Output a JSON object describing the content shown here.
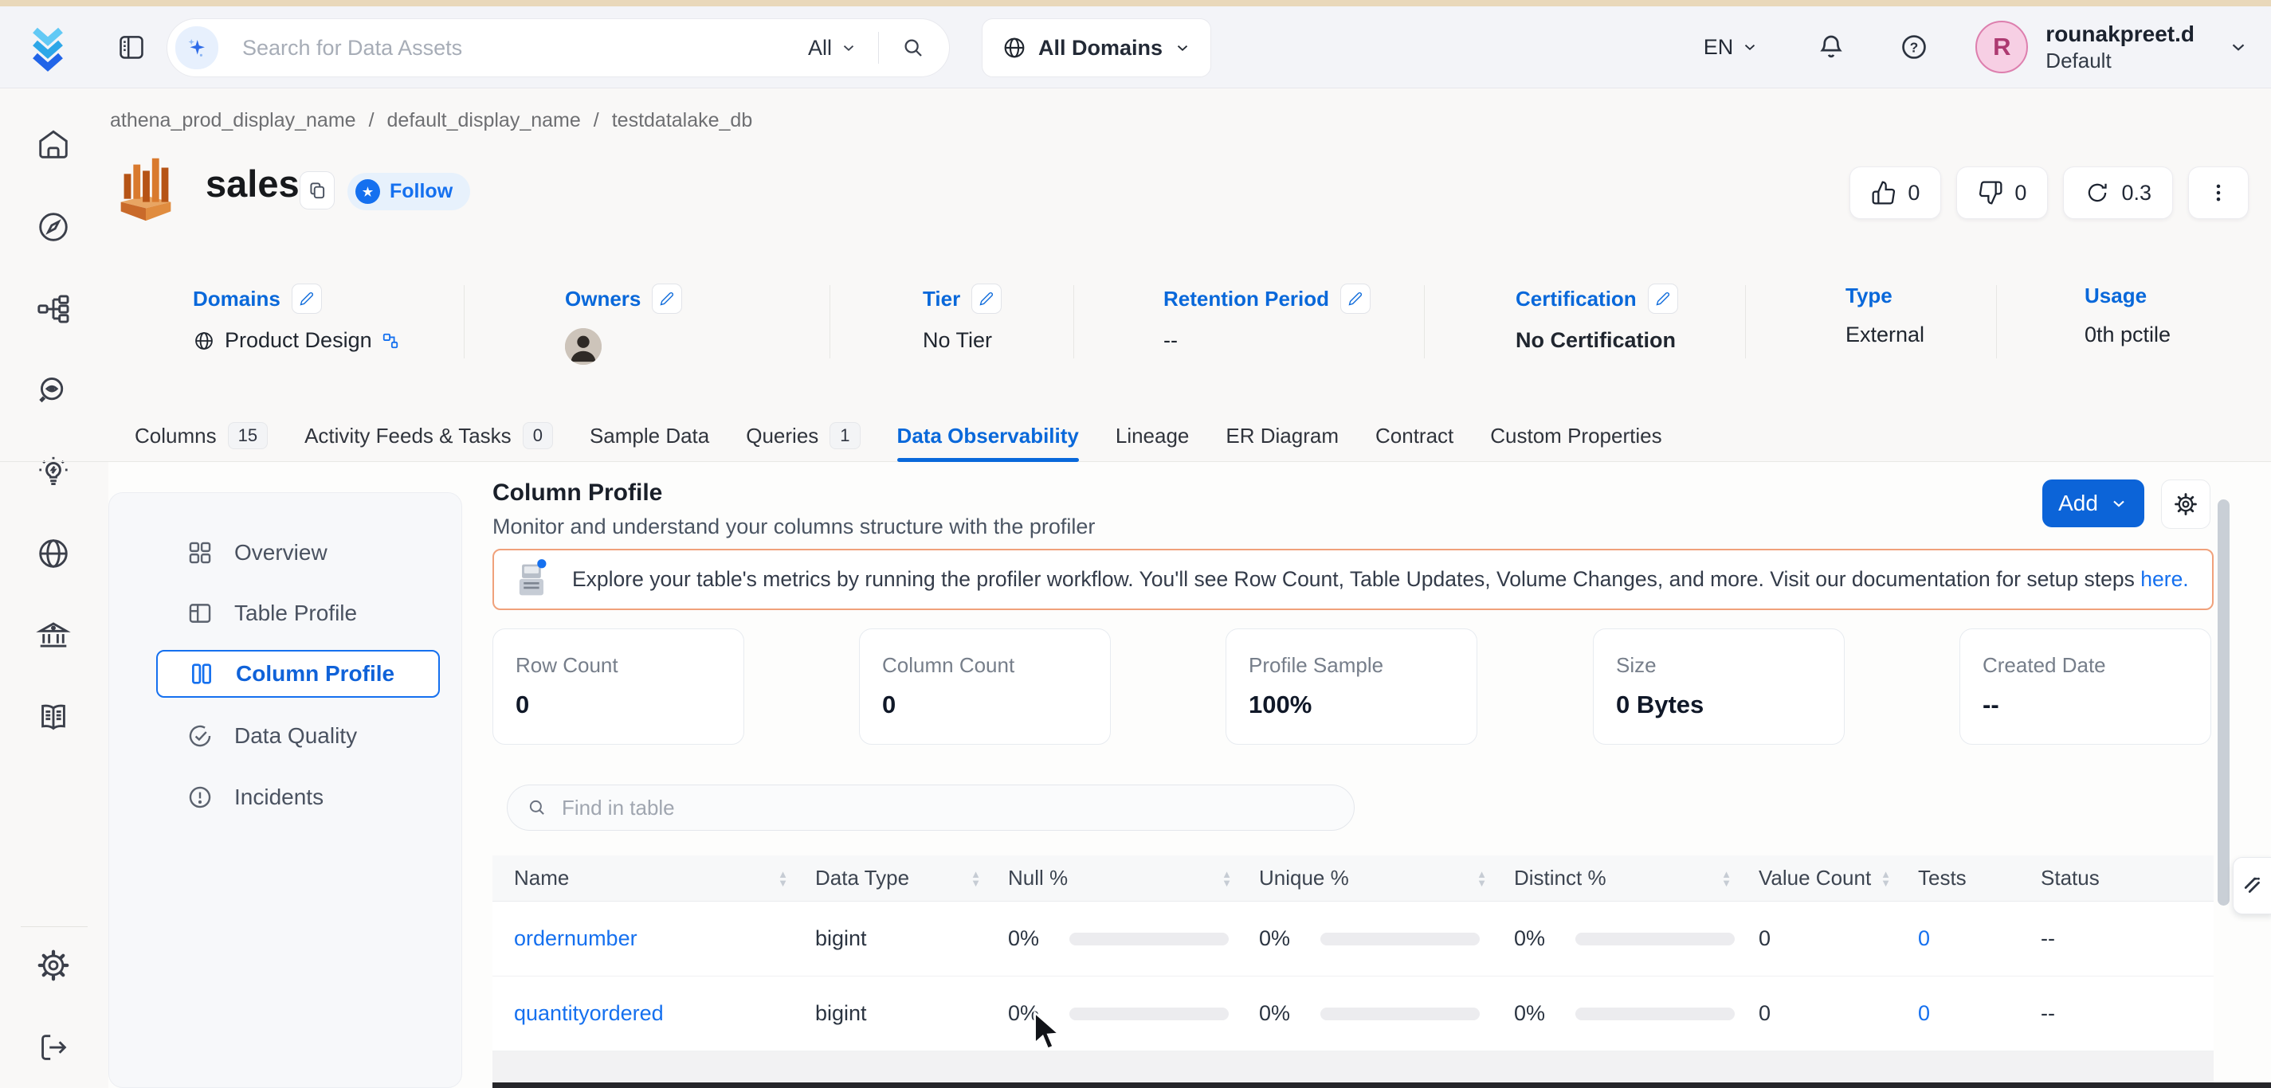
{
  "colors": {
    "accent": "#0968da",
    "button_blue": "#0c64d8",
    "banner_border": "#f0a17b",
    "avatar_pink": "#f7cfe4",
    "top_strip": "#e9d8ba"
  },
  "icons": {
    "question_mark": "?",
    "follow_star": "★",
    "caret_up": "▲",
    "caret_down": "▼"
  },
  "header": {
    "search_placeholder": "Search for Data Assets",
    "search_scope": "All",
    "domains_filter": "All Domains",
    "language": "EN",
    "user_name": "rounakpreet.d",
    "user_team": "Default",
    "avatar_initial": "R"
  },
  "breadcrumb": {
    "separator": "/",
    "items": [
      "athena_prod_display_name",
      "default_display_name",
      "testdatalake_db"
    ]
  },
  "entity": {
    "name": "sales",
    "follow_label": "Follow",
    "upvotes": "0",
    "downvotes": "0",
    "version": "0.3"
  },
  "metadata": {
    "domains": {
      "label": "Domains",
      "value": "Product Design"
    },
    "owners": {
      "label": "Owners"
    },
    "tier": {
      "label": "Tier",
      "value": "No Tier"
    },
    "retention": {
      "label": "Retention Period",
      "value": "--"
    },
    "certification": {
      "label": "Certification",
      "value": "No Certification"
    },
    "type": {
      "label": "Type",
      "value": "External"
    },
    "usage": {
      "label": "Usage",
      "value": "0th pctile"
    }
  },
  "tabs": [
    {
      "label": "Columns",
      "badge": "15"
    },
    {
      "label": "Activity Feeds & Tasks",
      "badge": "0"
    },
    {
      "label": "Sample Data"
    },
    {
      "label": "Queries",
      "badge": "1"
    },
    {
      "label": "Data Observability"
    },
    {
      "label": "Lineage"
    },
    {
      "label": "ER Diagram"
    },
    {
      "label": "Contract"
    },
    {
      "label": "Custom Properties"
    }
  ],
  "profile_nav": [
    {
      "label": "Overview"
    },
    {
      "label": "Table Profile"
    },
    {
      "label": "Column Profile"
    },
    {
      "label": "Data Quality"
    },
    {
      "label": "Incidents"
    }
  ],
  "main": {
    "title": "Column Profile",
    "subtitle": "Monitor and understand your columns structure with the profiler",
    "add_label": "Add",
    "banner": {
      "text": "Explore your table's metrics by running the profiler workflow. You'll see Row Count, Table Updates, Volume Changes, and more. Visit our documentation for setup steps ",
      "link": "here."
    },
    "stats": [
      {
        "label": "Row Count",
        "value": "0"
      },
      {
        "label": "Column Count",
        "value": "0"
      },
      {
        "label": "Profile Sample",
        "value": "100%"
      },
      {
        "label": "Size",
        "value": "0 Bytes"
      },
      {
        "label": "Created Date",
        "value": "--"
      }
    ],
    "find_placeholder": "Find in table",
    "table": {
      "columns": [
        "Name",
        "Data Type",
        "Null %",
        "Unique %",
        "Distinct %",
        "Value Count",
        "Tests",
        "Status"
      ],
      "rows": [
        {
          "name": "ordernumber",
          "type": "bigint",
          "null_pct": "0%",
          "unique_pct": "0%",
          "distinct_pct": "0%",
          "value_count": "0",
          "tests": "0",
          "status": "--"
        },
        {
          "name": "quantityordered",
          "type": "bigint",
          "null_pct": "0%",
          "unique_pct": "0%",
          "distinct_pct": "0%",
          "value_count": "0",
          "tests": "0",
          "status": "--"
        }
      ]
    }
  }
}
